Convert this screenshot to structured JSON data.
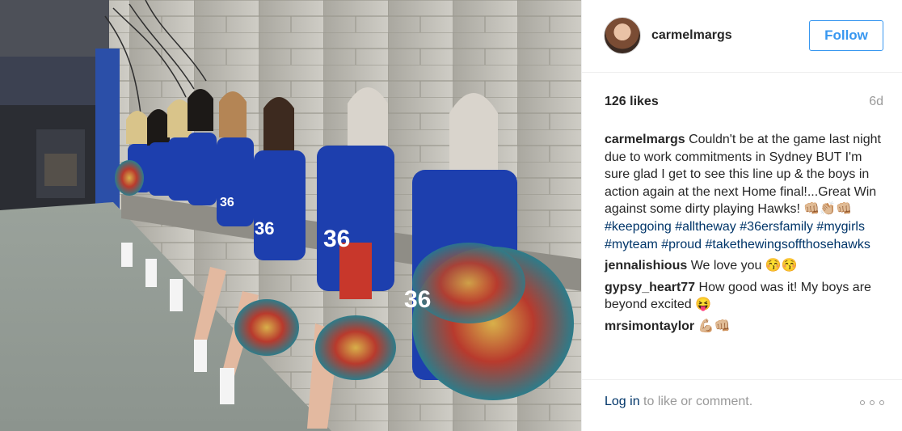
{
  "post": {
    "username": "carmelmargs",
    "follow_label": "Follow",
    "likes": "126 likes",
    "age": "6d",
    "comments": [
      {
        "user": "carmelmargs",
        "segments": [
          {
            "t": "text",
            "v": " Couldn't be at the game last night due to work commitments in Sydney BUT I'm sure glad I get to see this line up & the boys in action again at the next Home final!...Great Win against some dirty playing Hawks! 👊🏼👏🏼👊🏼 "
          },
          {
            "t": "tag",
            "v": "#keepgoing"
          },
          {
            "t": "text",
            "v": " "
          },
          {
            "t": "tag",
            "v": "#alltheway"
          },
          {
            "t": "text",
            "v": " "
          },
          {
            "t": "tag",
            "v": "#36ersfamily"
          },
          {
            "t": "text",
            "v": " "
          },
          {
            "t": "tag",
            "v": "#mygirls"
          },
          {
            "t": "text",
            "v": " "
          },
          {
            "t": "tag",
            "v": "#myteam"
          },
          {
            "t": "text",
            "v": " "
          },
          {
            "t": "tag",
            "v": "#proud"
          },
          {
            "t": "text",
            "v": " "
          },
          {
            "t": "tag",
            "v": "#takethewingsoffthosehawks"
          }
        ]
      },
      {
        "user": "jennalishious",
        "segments": [
          {
            "t": "text",
            "v": " We love you 😚😚"
          }
        ]
      },
      {
        "user": "gypsy_heart77",
        "segments": [
          {
            "t": "text",
            "v": " How good was it! My boys are beyond excited 😝"
          }
        ]
      },
      {
        "user": "mrsimontaylor",
        "segments": [
          {
            "t": "text",
            "v": " 💪🏼👊🏼"
          }
        ]
      }
    ],
    "login_link": "Log in",
    "login_rest": " to like or comment.",
    "more_icon": "more-options-icon"
  },
  "colors": {
    "link": "#003569",
    "follow_blue": "#3897f0",
    "muted": "#999999",
    "uniform_blue": "#1d3fae"
  },
  "photo": {
    "icon": "photo-cheerleaders",
    "jersey_numbers": [
      "36",
      "36",
      "36",
      "36"
    ]
  }
}
